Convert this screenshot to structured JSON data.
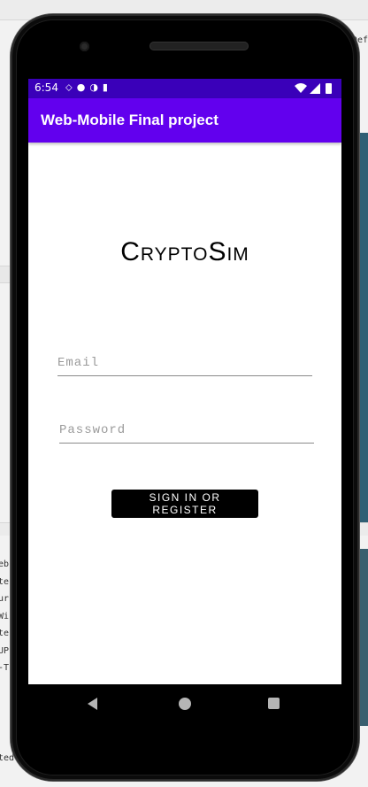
{
  "ide": {
    "code_fragments": [
      "eb",
      "te",
      "ur",
      "Wi",
      "te",
      "UP",
      "-T"
    ],
    "bottom_fragment": "ted",
    "right_fragment": "Def"
  },
  "status_bar": {
    "time": "6:54",
    "notification_icons": [
      "assistant-icon",
      "globe-icon",
      "media-icon",
      "sd-card-icon"
    ],
    "system_icons": [
      "wifi-icon",
      "signal-icon",
      "battery-icon"
    ]
  },
  "app_bar": {
    "title": "Web-Mobile Final project"
  },
  "logo": {
    "text": "CryptoSim"
  },
  "form": {
    "email_placeholder": "Email",
    "password_placeholder": "Password",
    "submit_label": "SIGN IN OR REGISTER"
  },
  "nav_bar": {
    "buttons": [
      "back-icon",
      "home-icon",
      "recents-icon"
    ]
  },
  "colors": {
    "status_bar": "#3a00b9",
    "app_bar": "#6200ee",
    "button": "#000000"
  }
}
